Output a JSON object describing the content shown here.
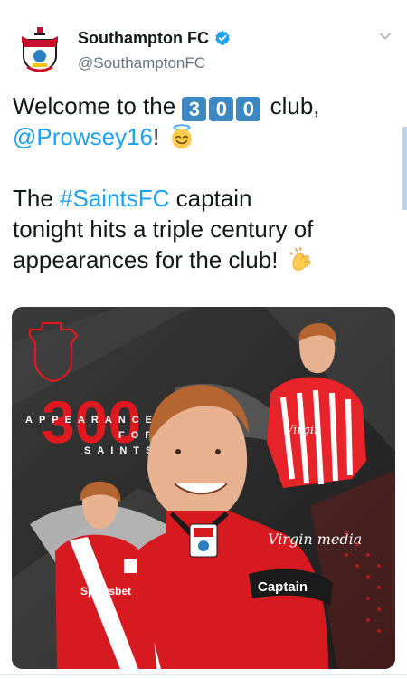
{
  "account": {
    "display_name": "Southampton FC",
    "handle": "@SouthamptonFC",
    "verified": true,
    "avatar_icon": "southampton-crest-icon"
  },
  "tweet": {
    "line1_pre": "Welcome to the ",
    "number_keys": [
      "3",
      "0",
      "0"
    ],
    "line1_post": " club,",
    "mention": "@Prowsey16",
    "mention_suffix": "!",
    "emoji1": "smiling-face-with-halo",
    "line3_hashtag": "#SaintsFC",
    "line3_rest": " captain",
    "line4": "tonight hits a triple century of",
    "line5": "appearances for the club!",
    "emoji2": "clapping-hands"
  },
  "media": {
    "graphic_number": "300",
    "graphic_word1": "APPEARANCES",
    "graphic_word2": "FOR",
    "graphic_word3": "SAINTS",
    "armband_text": "Captain",
    "sponsor_left": "Sportsbet",
    "sponsor_right": "Virgin media"
  },
  "colors": {
    "link": "#1da1f2",
    "saints_red": "#e0181f",
    "verified_blue": "#1da1f2"
  }
}
